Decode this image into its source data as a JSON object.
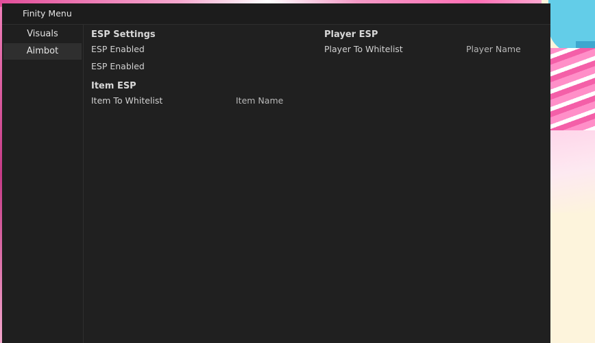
{
  "window": {
    "title": "Finity Menu"
  },
  "sidebar": {
    "items": [
      {
        "label": "Visuals"
      },
      {
        "label": "Aimbot"
      }
    ]
  },
  "main": {
    "esp_settings": {
      "title": "ESP Settings",
      "rows": [
        {
          "label": "ESP Enabled"
        },
        {
          "label": "ESP Enabled"
        }
      ]
    },
    "item_esp": {
      "title": "Item ESP",
      "row_label": "Item To Whitelist",
      "input_placeholder": "Item Name"
    },
    "player_esp": {
      "title": "Player ESP",
      "row_label": "Player To Whitelist",
      "input_placeholder": "Player Name"
    }
  },
  "colors": {
    "window_bg": "#202020",
    "titlebar_bg": "#1c1c1c",
    "selected_item_bg": "#2f2f2f",
    "text": "#e4e4e4"
  }
}
